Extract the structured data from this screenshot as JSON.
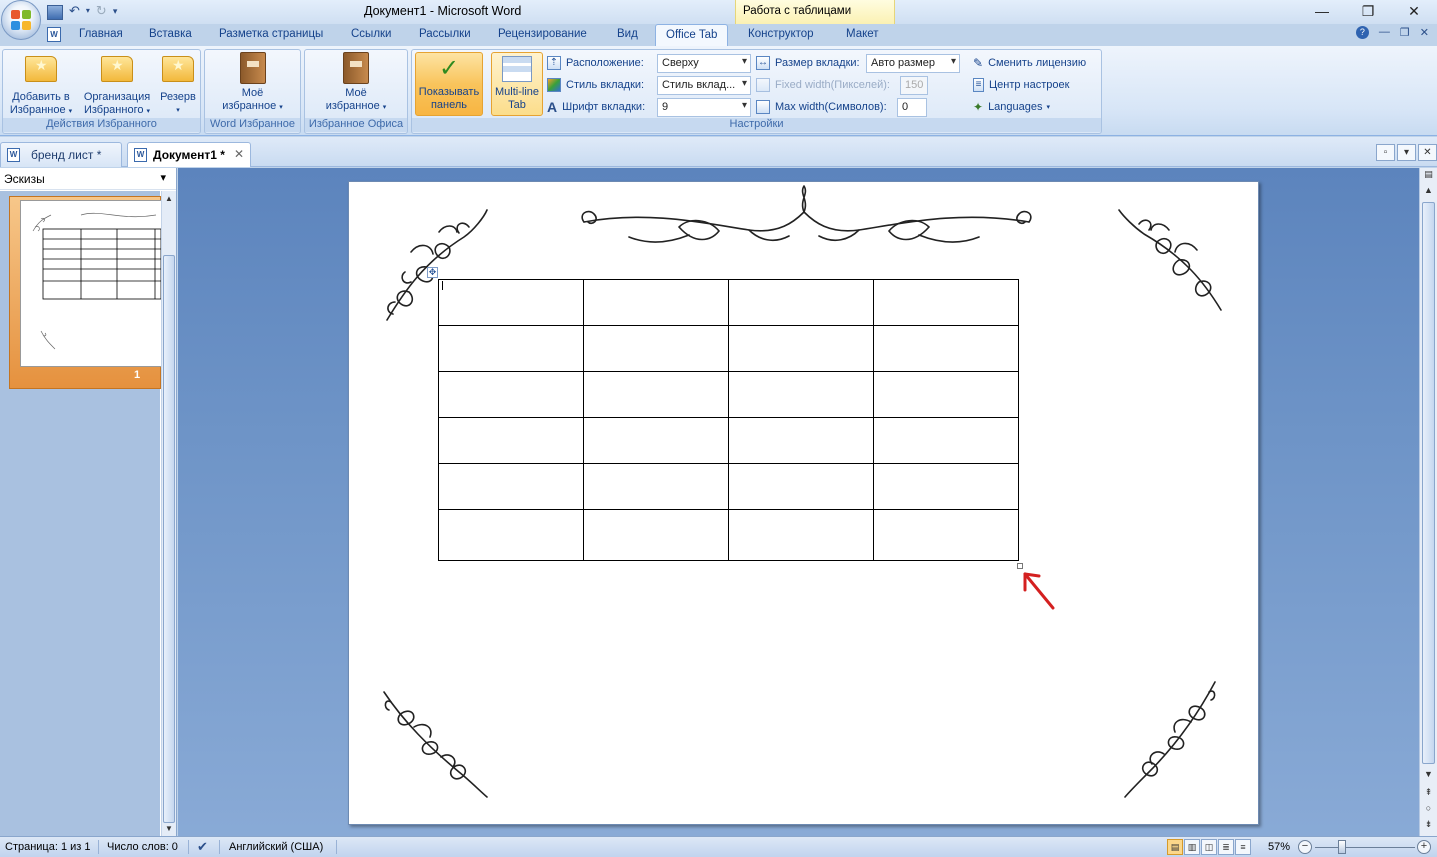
{
  "window": {
    "title": "Документ1 - Microsoft Word",
    "context_group": "Работа с таблицами"
  },
  "ribbon_tabs": [
    "Главная",
    "Вставка",
    "Разметка страницы",
    "Ссылки",
    "Рассылки",
    "Рецензирование",
    "Вид",
    "Office Tab",
    "Конструктор",
    "Макет"
  ],
  "active_tab": "Office Tab",
  "groups": {
    "favorites_actions": {
      "label": "Действия Избранного",
      "add_l1": "Добавить в",
      "add_l2": "Избранное",
      "organize_l1": "Организация",
      "organize_l2": "Избранного",
      "backup": "Резерв"
    },
    "word_favorites": {
      "label": "Word Избранное",
      "btn_l1": "Моё",
      "btn_l2": "избранное"
    },
    "office_favorites": {
      "label": "Избранное Офиса",
      "btn_l1": "Моё",
      "btn_l2": "избранное"
    },
    "settings": {
      "label": "Настройки",
      "show_panel_l1": "Показывать",
      "show_panel_l2": "панель",
      "multiline_l1": "Multi-line",
      "multiline_l2": "Tab",
      "position_label": "Расположение:",
      "position_value": "Сверху",
      "tab_style_label": "Стиль вкладки:",
      "tab_style_value": "Стиль вклад...",
      "tab_font_label": "Шрифт вкладки:",
      "tab_font_value": "9",
      "tab_size_label": "Размер вкладки:",
      "tab_size_value": "Авто размер",
      "fixed_width_label": "Fixed width(Пикселей):",
      "fixed_width_value": "150",
      "max_width_label": "Max width(Символов):",
      "max_width_value": "0",
      "change_license": "Сменить лицензию",
      "settings_center": "Центр настроек",
      "languages": "Languages"
    }
  },
  "doc_tabs": [
    {
      "label": "бренд лист *",
      "active": false
    },
    {
      "label": "Документ1 *",
      "active": true
    }
  ],
  "thumbnails": {
    "header": "Эскизы",
    "page_number": "1"
  },
  "table": {
    "rows": 6,
    "cols": 4
  },
  "statusbar": {
    "page": "Страница: 1 из 1",
    "words": "Число слов: 0",
    "language": "Английский (США)",
    "zoom": "57%"
  },
  "colors": {
    "accent": "#15428b",
    "annotation_arrow": "#d42020"
  }
}
